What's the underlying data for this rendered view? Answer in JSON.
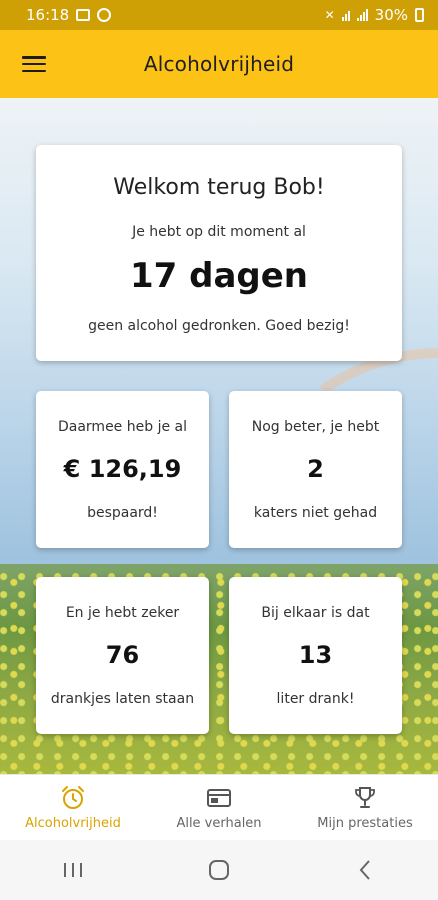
{
  "status_bar": {
    "time": "16:18",
    "battery": "30%"
  },
  "app_bar": {
    "title": "Alcoholvrijheid",
    "menu_icon": "hamburger-menu-icon"
  },
  "main_card": {
    "welcome": "Welkom terug Bob!",
    "intro": "Je hebt op dit moment al",
    "days": "17 dagen",
    "outro": "geen alcohol gedronken. Goed bezig!"
  },
  "stats": [
    {
      "top": "Daarmee heb je al",
      "value": "€ 126,19",
      "bottom": "bespaard!"
    },
    {
      "top": "Nog beter, je hebt",
      "value": "2",
      "bottom": "katers niet gehad"
    },
    {
      "top": "En je hebt zeker",
      "value": "76",
      "bottom": "drankjes laten staan"
    },
    {
      "top": "Bij elkaar is dat",
      "value": "13",
      "bottom": "liter drank!"
    }
  ],
  "bottom_nav": [
    {
      "label": "Alcoholvrijheid",
      "icon": "alarm-clock-icon",
      "active": true
    },
    {
      "label": "Alle verhalen",
      "icon": "browser-window-icon",
      "active": false
    },
    {
      "label": "Mijn prestaties",
      "icon": "trophy-icon",
      "active": false
    }
  ],
  "colors": {
    "app_bar": "#fcc316",
    "status_bar": "#cf9f06",
    "active_nav": "#d9a400"
  }
}
